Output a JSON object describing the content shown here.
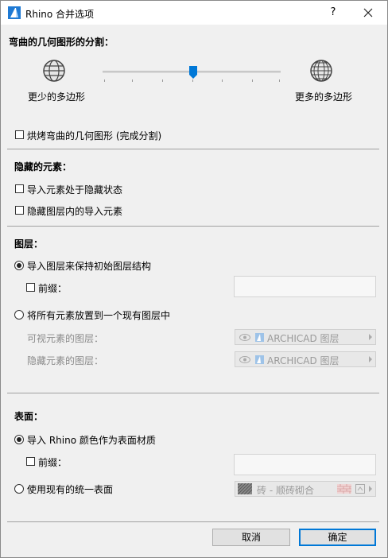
{
  "window": {
    "title": "Rhino 合并选项",
    "help_label": "?"
  },
  "segmentation": {
    "heading": "弯曲的几何图形的分割：",
    "less_label": "更少的多边形",
    "more_label": "更多的多边形",
    "slider_level": 0.5,
    "bake_label": "烘烤弯曲的几何图形 (完成分割)",
    "bake_checked": false
  },
  "hidden": {
    "heading": "隐藏的元素：",
    "import_hidden_label": "导入元素处于隐藏状态",
    "import_hidden_checked": false,
    "hide_in_layer_label": "隐藏图层内的导入元素",
    "hide_in_layer_checked": false
  },
  "layers": {
    "heading": "图层：",
    "keep_structure_label": "导入图层来保持初始图层结构",
    "prefix_label": "前缀：",
    "prefix_value": "",
    "place_existing_label": "将所有元素放置到一个现有图层中",
    "visible_layer_label": "可视元素的图层：",
    "visible_layer_value": "ARCHICAD 图层",
    "hidden_layer_label": "隐藏元素的图层：",
    "hidden_layer_value": "ARCHICAD 图层",
    "selected": "keep_structure"
  },
  "surfaces": {
    "heading": "表面：",
    "import_colors_label": "导入 Rhino 颜色作为表面材质",
    "prefix_label": "前缀：",
    "prefix_value": "",
    "use_existing_label": "使用现有的统一表面",
    "surface_value": "砖 - 顺砖砌合",
    "selected": "import_colors"
  },
  "footer": {
    "cancel_label": "取消",
    "ok_label": "确定"
  },
  "colors": {
    "accent": "#0078d7",
    "icon_blue": "#1f7ad4"
  }
}
